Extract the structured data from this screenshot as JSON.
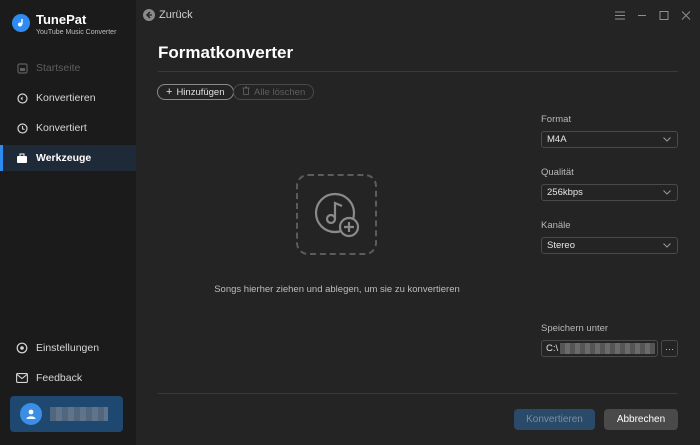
{
  "app": {
    "name": "TunePat",
    "subtitle": "YouTube Music Converter"
  },
  "nav": {
    "home": "Startseite",
    "convert": "Konvertieren",
    "converted": "Konvertiert",
    "tools": "Werkzeuge",
    "settings": "Einstellungen",
    "feedback": "Feedback"
  },
  "topbar": {
    "back_label": "Zurück"
  },
  "page": {
    "title": "Formatkonverter",
    "add_label": "Hinzufügen",
    "clear_label": "Alle löschen",
    "drop_text": "Songs hierher ziehen und ablegen, um sie zu konvertieren"
  },
  "settings": {
    "format_label": "Format",
    "format_value": "M4A",
    "quality_label": "Qualität",
    "quality_value": "256kbps",
    "channels_label": "Kanäle",
    "channels_value": "Stereo",
    "save_label": "Speichern unter",
    "save_path_prefix": "C:\\",
    "more_label": "···"
  },
  "actions": {
    "convert": "Konvertieren",
    "cancel": "Abbrechen"
  },
  "colors": {
    "accent": "#2e8bf0",
    "background": "#242424",
    "sidebar": "#1b1b1b"
  }
}
